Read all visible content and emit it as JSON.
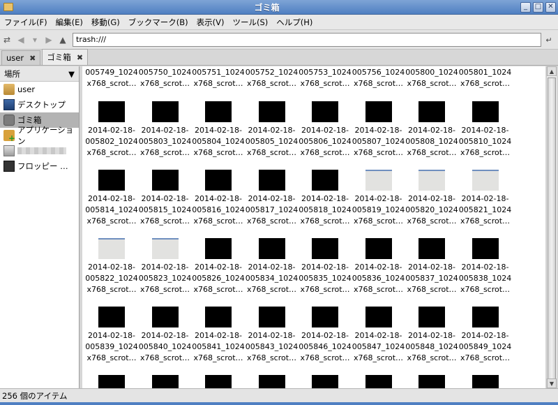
{
  "window": {
    "title": "ゴミ箱"
  },
  "menu": [
    "ファイル(F)",
    "編集(E)",
    "移動(G)",
    "ブックマーク(B)",
    "表示(V)",
    "ツール(S)",
    "ヘルプ(H)"
  ],
  "toolbar": {
    "location": "trash:///"
  },
  "tabs": [
    {
      "label": "user",
      "active": false
    },
    {
      "label": "ゴミ箱",
      "active": true
    }
  ],
  "sidebar": {
    "header": "場所",
    "items": [
      {
        "label": "user",
        "icon": "home-icon"
      },
      {
        "label": "デスクトップ",
        "icon": "desktop-icon"
      },
      {
        "label": "ゴミ箱",
        "icon": "trash-icon",
        "selected": true
      },
      {
        "label": "アプリケーション",
        "icon": "applications-icon"
      },
      {
        "label": "",
        "icon": "drive-icon"
      },
      {
        "label": "フロッピー …",
        "icon": "floppy-icon"
      }
    ]
  },
  "files": {
    "rows": [
      {
        "partial": true,
        "items": [
          {
            "l2": "005749_1024",
            "l3": "x768_scrot…"
          },
          {
            "l2": "005750_1024",
            "l3": "x768_scrot…"
          },
          {
            "l2": "005751_1024",
            "l3": "x768_scrot…"
          },
          {
            "l2": "005752_1024",
            "l3": "x768_scrot…"
          },
          {
            "l2": "005753_1024",
            "l3": "x768_scrot…"
          },
          {
            "l2": "005756_1024",
            "l3": "x768_scrot…"
          },
          {
            "l2": "005800_1024",
            "l3": "x768_scrot…"
          },
          {
            "l2": "005801_1024",
            "l3": "x768_scrot…"
          }
        ]
      },
      {
        "items": [
          {
            "l1": "2014-02-18-",
            "l2": "005802_1024",
            "l3": "x768_scrot…",
            "thumb": "black"
          },
          {
            "l1": "2014-02-18-",
            "l2": "005803_1024",
            "l3": "x768_scrot…",
            "thumb": "black"
          },
          {
            "l1": "2014-02-18-",
            "l2": "005804_1024",
            "l3": "x768_scrot…",
            "thumb": "black"
          },
          {
            "l1": "2014-02-18-",
            "l2": "005805_1024",
            "l3": "x768_scrot…",
            "thumb": "black"
          },
          {
            "l1": "2014-02-18-",
            "l2": "005806_1024",
            "l3": "x768_scrot…",
            "thumb": "black"
          },
          {
            "l1": "2014-02-18-",
            "l2": "005807_1024",
            "l3": "x768_scrot…",
            "thumb": "black"
          },
          {
            "l1": "2014-02-18-",
            "l2": "005808_1024",
            "l3": "x768_scrot…",
            "thumb": "black"
          },
          {
            "l1": "2014-02-18-",
            "l2": "005810_1024",
            "l3": "x768_scrot…",
            "thumb": "black"
          }
        ]
      },
      {
        "items": [
          {
            "l1": "2014-02-18-",
            "l2": "005814_1024",
            "l3": "x768_scrot…",
            "thumb": "black"
          },
          {
            "l1": "2014-02-18-",
            "l2": "005815_1024",
            "l3": "x768_scrot…",
            "thumb": "black"
          },
          {
            "l1": "2014-02-18-",
            "l2": "005816_1024",
            "l3": "x768_scrot…",
            "thumb": "black"
          },
          {
            "l1": "2014-02-18-",
            "l2": "005817_1024",
            "l3": "x768_scrot…",
            "thumb": "black"
          },
          {
            "l1": "2014-02-18-",
            "l2": "005818_1024",
            "l3": "x768_scrot…",
            "thumb": "black"
          },
          {
            "l1": "2014-02-18-",
            "l2": "005819_1024",
            "l3": "x768_scrot…",
            "thumb": "light"
          },
          {
            "l1": "2014-02-18-",
            "l2": "005820_1024",
            "l3": "x768_scrot…",
            "thumb": "light"
          },
          {
            "l1": "2014-02-18-",
            "l2": "005821_1024",
            "l3": "x768_scrot…",
            "thumb": "light"
          }
        ]
      },
      {
        "items": [
          {
            "l1": "2014-02-18-",
            "l2": "005822_1024",
            "l3": "x768_scrot…",
            "thumb": "light"
          },
          {
            "l1": "2014-02-18-",
            "l2": "005823_1024",
            "l3": "x768_scrot…",
            "thumb": "light"
          },
          {
            "l1": "2014-02-18-",
            "l2": "005826_1024",
            "l3": "x768_scrot…",
            "thumb": "black"
          },
          {
            "l1": "2014-02-18-",
            "l2": "005834_1024",
            "l3": "x768_scrot…",
            "thumb": "black"
          },
          {
            "l1": "2014-02-18-",
            "l2": "005835_1024",
            "l3": "x768_scrot…",
            "thumb": "black"
          },
          {
            "l1": "2014-02-18-",
            "l2": "005836_1024",
            "l3": "x768_scrot…",
            "thumb": "black"
          },
          {
            "l1": "2014-02-18-",
            "l2": "005837_1024",
            "l3": "x768_scrot…",
            "thumb": "black"
          },
          {
            "l1": "2014-02-18-",
            "l2": "005838_1024",
            "l3": "x768_scrot…",
            "thumb": "black"
          }
        ]
      },
      {
        "items": [
          {
            "l1": "2014-02-18-",
            "l2": "005839_1024",
            "l3": "x768_scrot…",
            "thumb": "black"
          },
          {
            "l1": "2014-02-18-",
            "l2": "005840_1024",
            "l3": "x768_scrot…",
            "thumb": "black"
          },
          {
            "l1": "2014-02-18-",
            "l2": "005841_1024",
            "l3": "x768_scrot…",
            "thumb": "black"
          },
          {
            "l1": "2014-02-18-",
            "l2": "005843_1024",
            "l3": "x768_scrot…",
            "thumb": "black"
          },
          {
            "l1": "2014-02-18-",
            "l2": "005846_1024",
            "l3": "x768_scrot…",
            "thumb": "black"
          },
          {
            "l1": "2014-02-18-",
            "l2": "005847_1024",
            "l3": "x768_scrot…",
            "thumb": "black"
          },
          {
            "l1": "2014-02-18-",
            "l2": "005848_1024",
            "l3": "x768_scrot…",
            "thumb": "black"
          },
          {
            "l1": "2014-02-18-",
            "l2": "005849_1024",
            "l3": "x768_scrot…",
            "thumb": "black"
          }
        ]
      },
      {
        "items": [
          {
            "thumb": "black"
          },
          {
            "thumb": "black"
          },
          {
            "thumb": "black"
          },
          {
            "thumb": "black"
          },
          {
            "thumb": "black"
          },
          {
            "thumb": "black"
          },
          {
            "thumb": "black"
          },
          {
            "thumb": "black"
          }
        ]
      }
    ]
  },
  "status": {
    "text": "256 個のアイテム"
  }
}
